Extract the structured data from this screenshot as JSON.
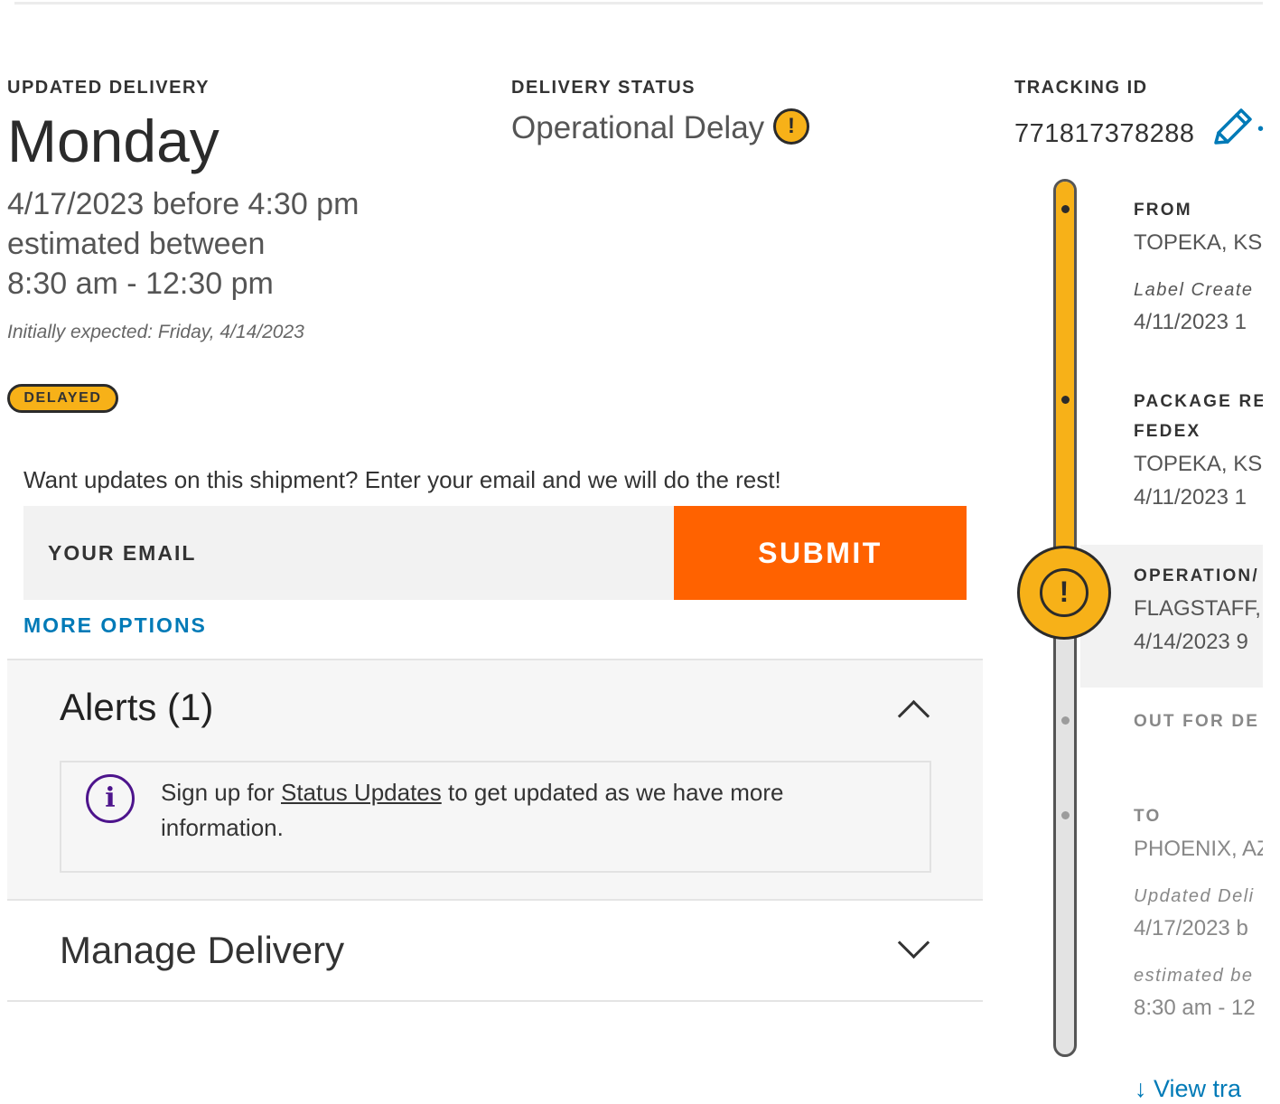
{
  "delivery": {
    "label": "UPDATED DELIVERY",
    "day": "Monday",
    "date": "4/17/2023 before 4:30 pm",
    "estimate_label": "estimated between",
    "window": "8:30 am - 12:30 pm",
    "initially_expected": "Initially expected: Friday, 4/14/2023",
    "badge": "DELAYED"
  },
  "status": {
    "label": "DELIVERY STATUS",
    "value": "Operational Delay",
    "icon": "warning-icon",
    "icon_glyph": "!"
  },
  "signup": {
    "prompt": "Want updates on this shipment? Enter your email and we will do the rest!",
    "email_placeholder": "YOUR EMAIL",
    "submit_label": "SUBMIT",
    "more_options": "MORE OPTIONS"
  },
  "alerts": {
    "title": "Alerts (1)",
    "message_before": "Sign up for ",
    "message_link": "Status Updates",
    "message_after": " to get updated as we have more information.",
    "info_glyph": "i"
  },
  "manage": {
    "title": "Manage Delivery"
  },
  "tracking": {
    "label": "TRACKING ID",
    "id": "771817378288",
    "clipped_edge": "•",
    "events": {
      "from_head": "FROM",
      "from_city": "TOPEKA, KS",
      "label_created": "Label Create",
      "label_date": "4/11/2023 1",
      "received_head": "PACKAGE RE",
      "received_carrier": "FEDEX",
      "received_city": "TOPEKA, KS",
      "received_date": "4/11/2023 1",
      "operational_head": "OPERATION/",
      "operational_city": "FLAGSTAFF,",
      "operational_date": "4/14/2023 9",
      "out_head": "OUT FOR DE",
      "to_head": "TO",
      "to_city": "PHOENIX, AZ",
      "updated_label": "Updated Deli",
      "updated_date": "4/17/2023 b",
      "estimated_label": "estimated be",
      "estimated_window": "8:30 am - 12"
    },
    "view_link": "↓ View tra"
  },
  "colors": {
    "accent_orange": "#ff6200",
    "delay_yellow": "#f7b118",
    "link_blue": "#007ab7",
    "info_purple": "#4d148c"
  }
}
